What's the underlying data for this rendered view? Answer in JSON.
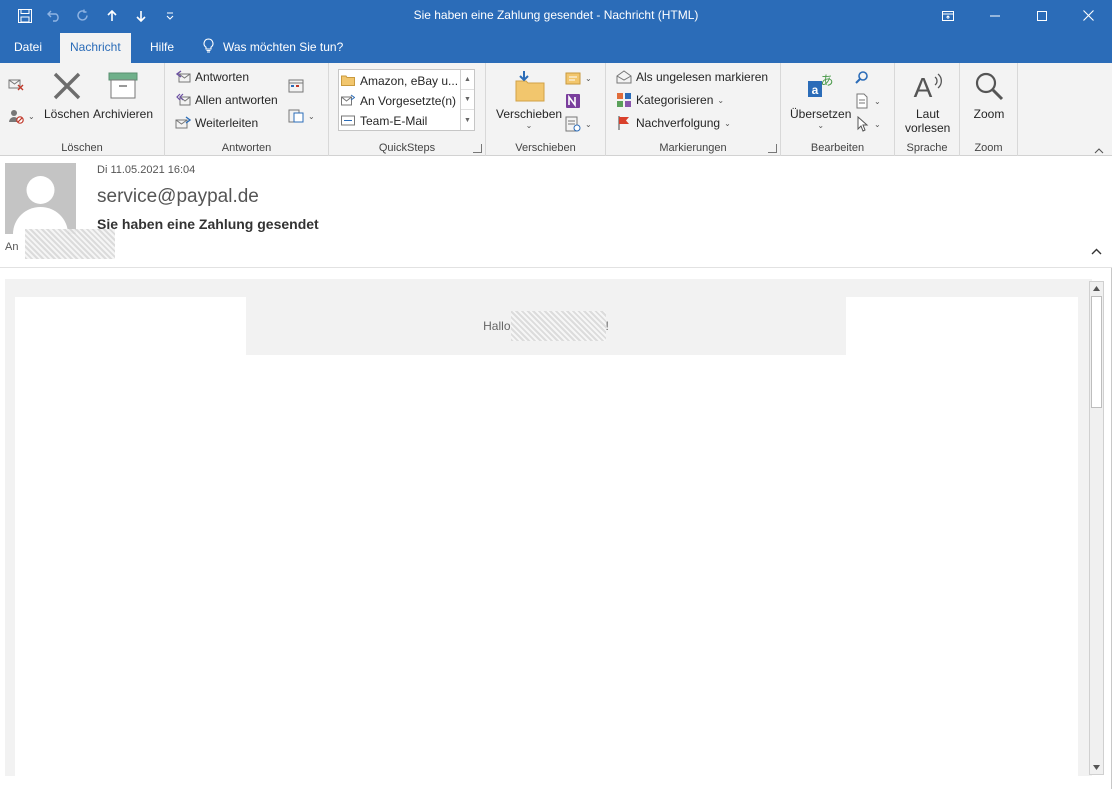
{
  "window": {
    "title": "Sie haben eine Zahlung gesendet  -  Nachricht (HTML)"
  },
  "qat": {
    "icons": [
      "save-icon",
      "undo-icon",
      "redo-icon",
      "up-arrow-icon",
      "down-arrow-icon",
      "customize-icon"
    ]
  },
  "tabs": [
    {
      "label": "Datei"
    },
    {
      "label": "Nachricht"
    },
    {
      "label": "Hilfe"
    }
  ],
  "tellme": {
    "label": "Was möchten Sie tun?"
  },
  "ribbon": {
    "loeschen": {
      "delete_label": "Löschen",
      "archive_label": "Archivieren",
      "group_label": "Löschen"
    },
    "antworten": {
      "reply": "Antworten",
      "reply_all": "Allen antworten",
      "forward": "Weiterleiten",
      "group_label": "Antworten"
    },
    "quicksteps": {
      "items": [
        "Amazon, eBay u...",
        "An Vorgesetzte(n)",
        "Team-E-Mail"
      ],
      "group_label": "QuickSteps"
    },
    "verschieben": {
      "move_label": "Verschieben",
      "group_label": "Verschieben"
    },
    "markierungen": {
      "unread": "Als ungelesen markieren",
      "categorize": "Kategorisieren",
      "followup": "Nachverfolgung",
      "group_label": "Markierungen"
    },
    "bearbeiten": {
      "translate": "Übersetzen",
      "group_label": "Bearbeiten"
    },
    "sprache": {
      "read_aloud_1": "Laut",
      "read_aloud_2": "vorlesen",
      "group_label": "Sprache"
    },
    "zoom": {
      "zoom_label": "Zoom",
      "group_label": "Zoom"
    }
  },
  "message": {
    "date": "Di 11.05.2021 16:04",
    "sender": "service@paypal.de",
    "subject": "Sie haben eine Zahlung gesendet",
    "to_label": "An"
  },
  "body": {
    "greeting_prefix": "Hallo",
    "greeting_suffix": "!"
  },
  "colors": {
    "title_bar": "#2b6cb8",
    "ribbon_bg": "#f3f3f3"
  }
}
